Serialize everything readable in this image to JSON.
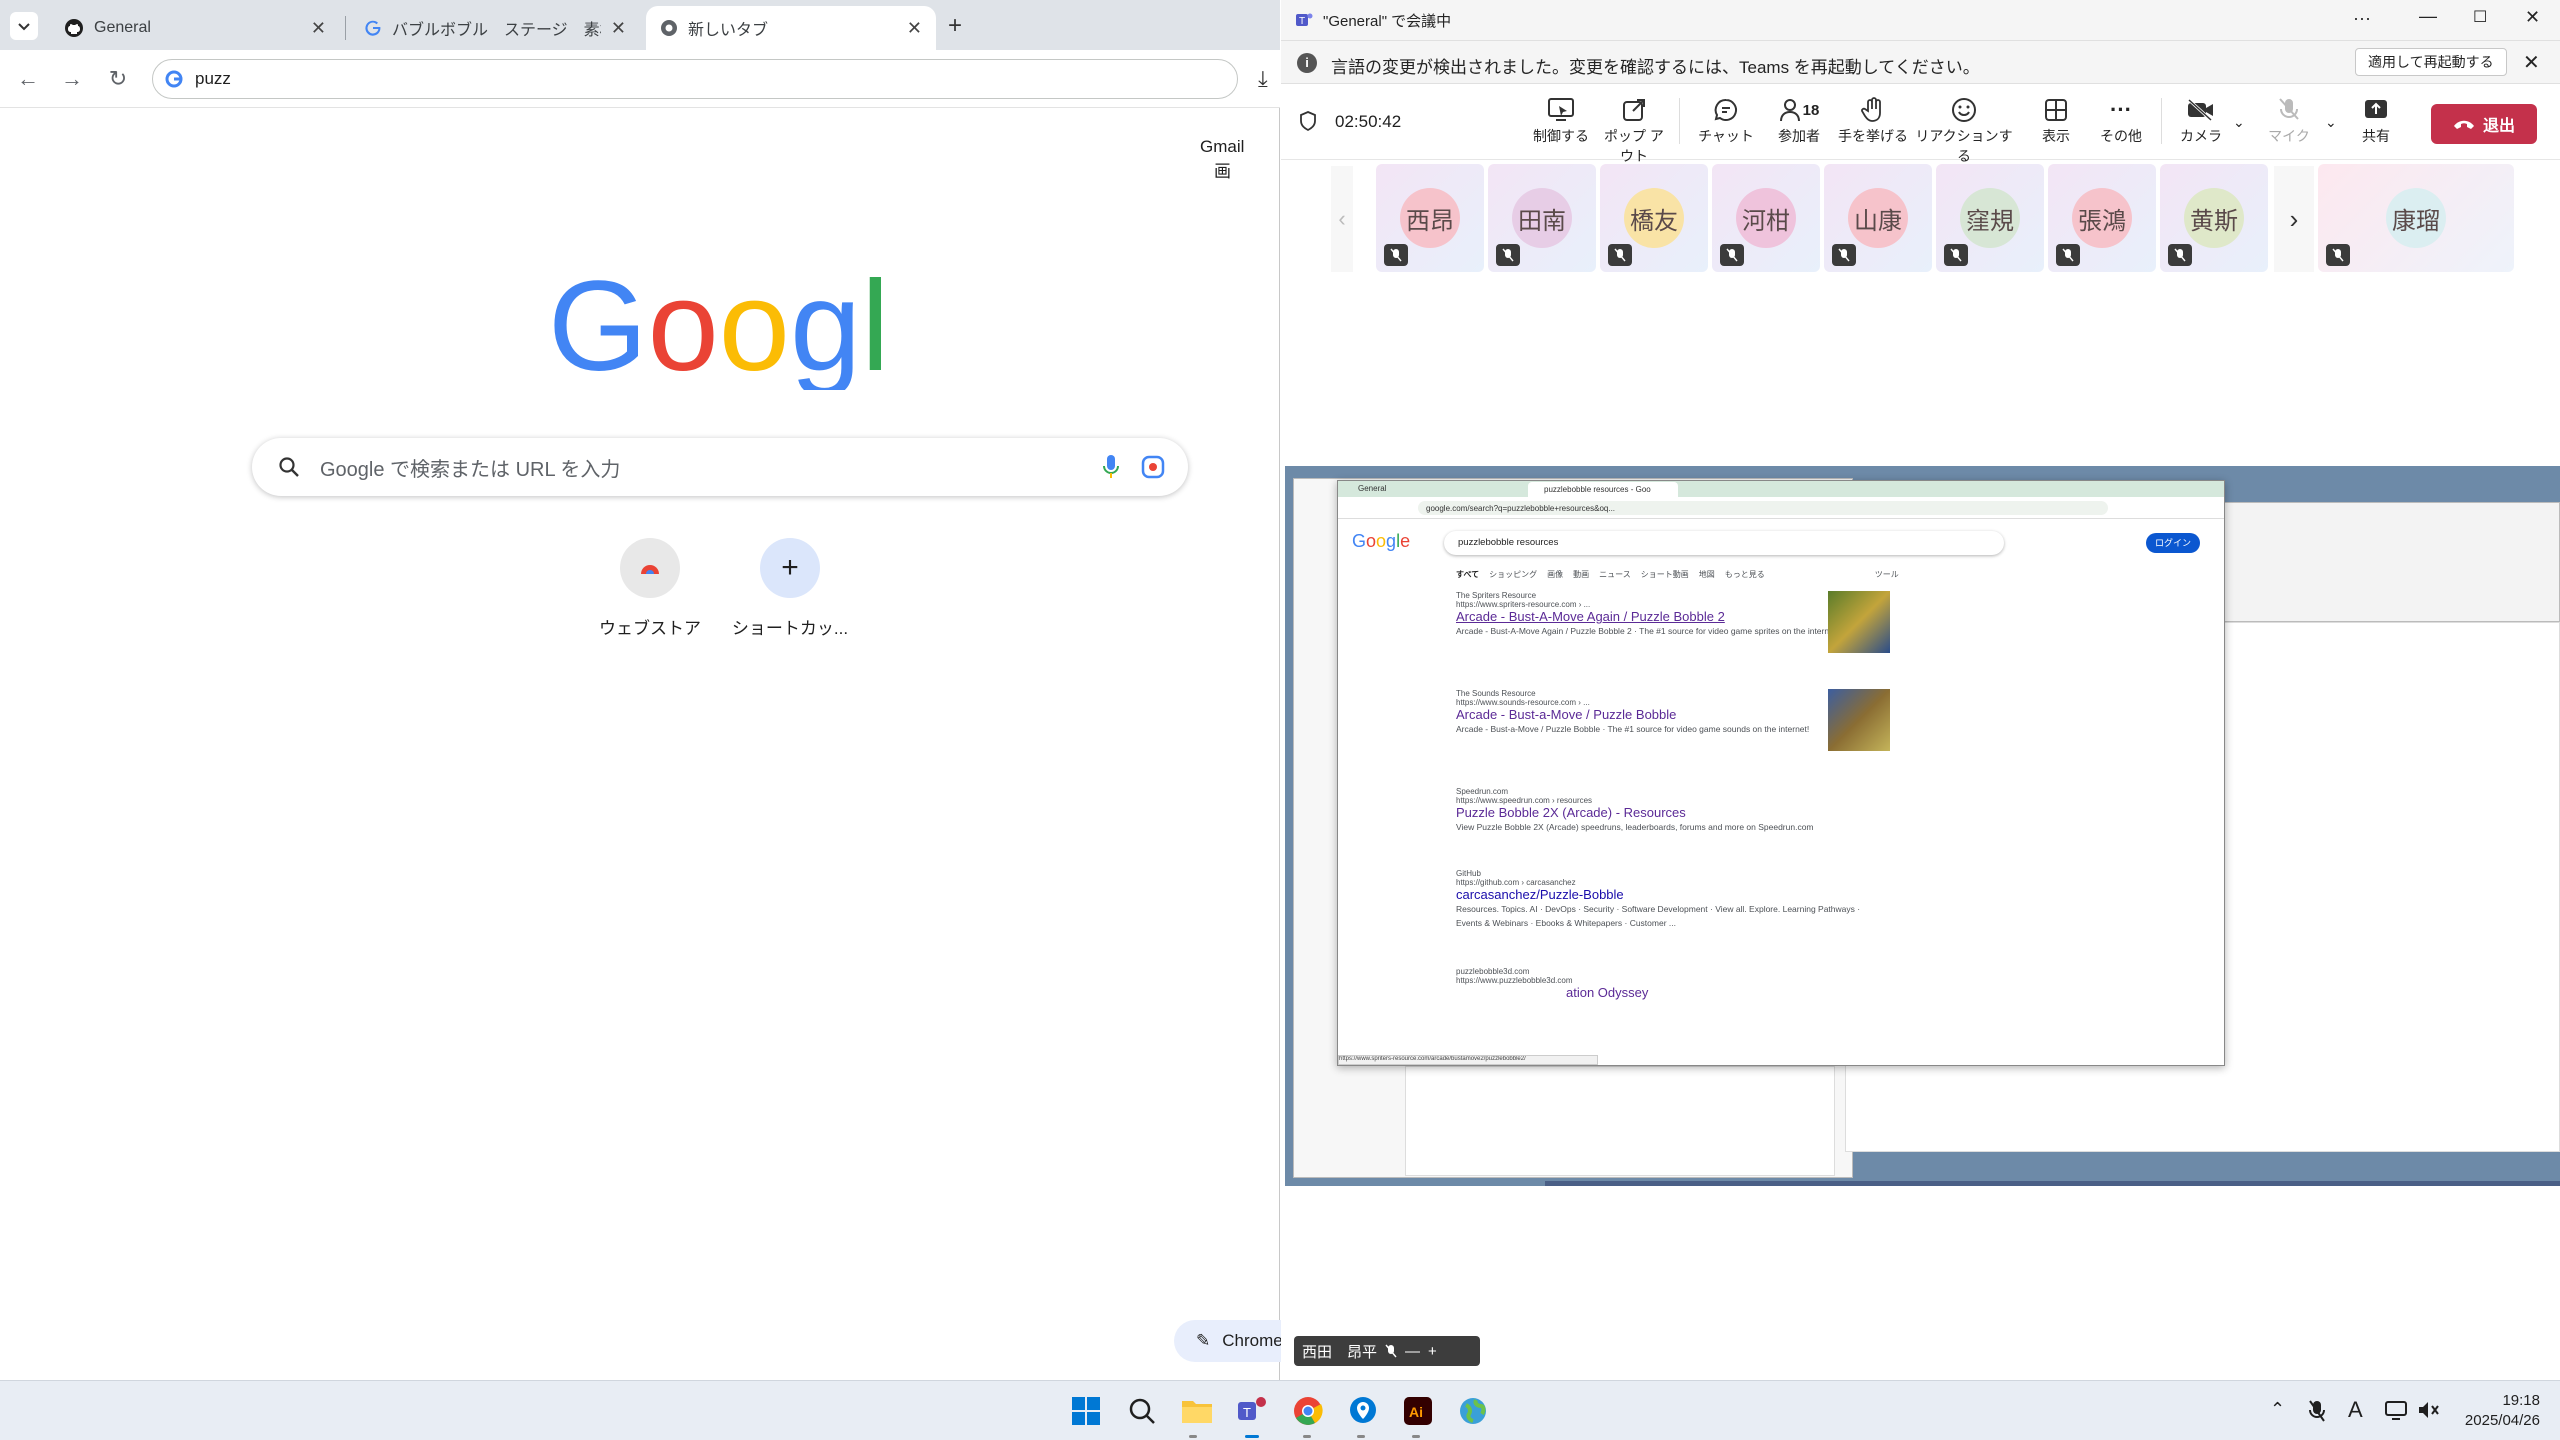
{
  "chrome": {
    "tabs": [
      {
        "label": "General"
      },
      {
        "label": "バブルボブル　ステージ　素材 - Go"
      },
      {
        "label": "新しいタブ"
      }
    ],
    "omnibox_value": "puzz",
    "top_links": [
      "Gmail",
      "画"
    ],
    "search_placeholder": "Google で検索または URL を入力",
    "shortcuts": [
      {
        "label": "ウェブストア"
      },
      {
        "label": "ショートカッ..."
      }
    ],
    "customize_label": "Chrome"
  },
  "teams": {
    "title": "\"General\" で会議中",
    "banner_text": "言語の変更が検出されました。変更を確認するには、Teams を再起動してください。",
    "banner_button": "適用して再起動する",
    "timer": "02:50:42",
    "toolbar": [
      {
        "label": "制御する",
        "icon": "control-icon"
      },
      {
        "label": "ポップ アウト",
        "icon": "popout-icon"
      },
      {
        "label": "チャット",
        "icon": "chat-icon"
      },
      {
        "label": "参加者",
        "icon": "people-icon",
        "count": "18"
      },
      {
        "label": "手を挙げる",
        "icon": "hand-icon"
      },
      {
        "label": "リアクションする",
        "icon": "reaction-icon"
      },
      {
        "label": "表示",
        "icon": "view-icon"
      },
      {
        "label": "その他",
        "icon": "more-icon"
      },
      {
        "label": "カメラ",
        "icon": "camera-off-icon"
      },
      {
        "label": "マイク",
        "icon": "mic-off-icon"
      },
      {
        "label": "共有",
        "icon": "share-icon"
      }
    ],
    "leave_label": "退出",
    "participants": [
      "西昂",
      "田南",
      "橋友",
      "河柑",
      "山康",
      "窪規",
      "張鴻",
      "黄斯",
      "康瑠"
    ],
    "presenter_name": "西田　昂平"
  },
  "shared_screen": {
    "tabs": [
      "General",
      "puzzlebobble resources - Goo"
    ],
    "url": "google.com/search?q=puzzlebobble+resources&oq...",
    "search_query": "puzzlebobble resources",
    "login": "ログイン",
    "filters": [
      "すべて",
      "ショッピング",
      "画像",
      "動画",
      "ニュース",
      "ショート動画",
      "地図",
      "もっと見る",
      "ツール"
    ],
    "results": [
      {
        "site": "The Spriters Resource",
        "url": "https://www.spriters-resource.com › ...",
        "title": "Arcade - Bust-A-Move Again / Puzzle Bobble 2",
        "desc": "Arcade - Bust-A-Move Again / Puzzle Bobble 2 · The #1 source for video game sprites on the internet!"
      },
      {
        "site": "The Sounds Resource",
        "url": "https://www.sounds-resource.com › ...",
        "title": "Arcade - Bust-a-Move / Puzzle Bobble",
        "desc": "Arcade - Bust-a-Move / Puzzle Bobble · The #1 source for video game sounds on the internet!"
      },
      {
        "site": "Speedrun.com",
        "url": "https://www.speedrun.com › resources",
        "title": "Puzzle Bobble 2X (Arcade) - Resources",
        "desc": "View Puzzle Bobble 2X (Arcade) speedruns, leaderboards, forums and more on Speedrun.com"
      },
      {
        "site": "GitHub",
        "url": "https://github.com › carcasanchez",
        "title": "carcasanchez/Puzzle-Bobble",
        "desc": "Resources. Topics. AI · DevOps · Security · Software Development · View all. Explore. Learning Pathways · Events & Webinars · Ebooks & Whitepapers · Customer ..."
      },
      {
        "site": "puzzlebobble3d.com",
        "url": "https://www.puzzlebobble3d.com",
        "title": "ation Odyssey",
        "desc": ""
      }
    ],
    "status_url": "https://www.spriters-resource.com/arcade/bustamove2/puzzlebobble2/"
  },
  "taskbar": {
    "time": "19:18",
    "date": "2025/04/26",
    "ime": "A"
  }
}
